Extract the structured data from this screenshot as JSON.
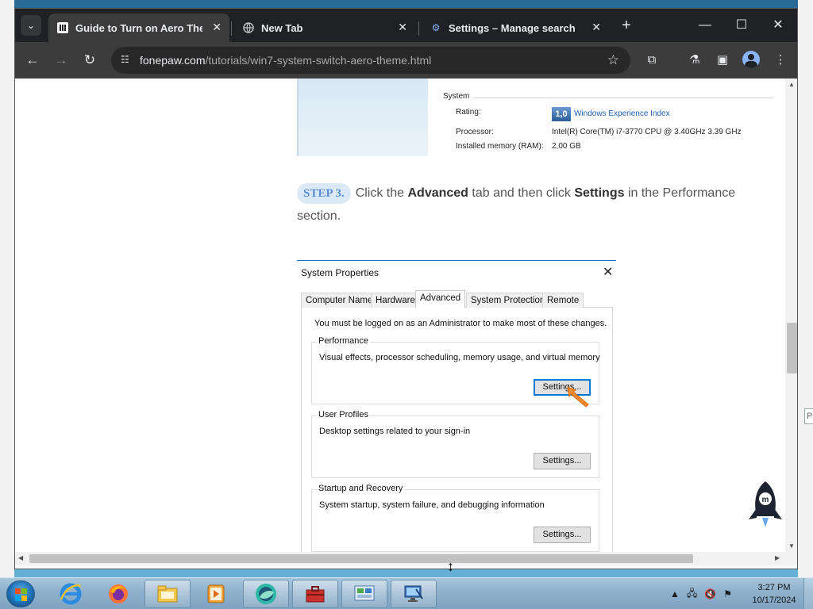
{
  "browser": {
    "tabs": [
      {
        "title": "Guide to Turn on Aero Theme",
        "favicon": "fonepaw-icon",
        "active": true
      },
      {
        "title": "New Tab",
        "favicon": "globe-icon",
        "active": false
      },
      {
        "title": "Settings – Manage search engi",
        "favicon": "gear-icon",
        "active": false
      }
    ],
    "url_host": "fonepaw.com",
    "url_path": "/tutorials/win7-system-switch-aero-theme.html"
  },
  "page": {
    "system_section": {
      "heading": "System",
      "rating_label": "Rating:",
      "rating_value": "1,0",
      "rating_link": "Windows Experience Index",
      "processor_label": "Processor:",
      "processor_value": "Intel(R) Core(TM) i7-3770 CPU @ 3.40GHz   3.39 GHz",
      "memory_label": "Installed memory (RAM):",
      "memory_value": "2,00 GB"
    },
    "step": {
      "badge": "STEP 3.",
      "text_1": "Click the ",
      "bold_1": "Advanced",
      "text_2": " tab and then click ",
      "bold_2": "Settings",
      "text_3": " in the Performance section."
    },
    "dialog": {
      "title": "System Properties",
      "close": "✕",
      "tabs": [
        "Computer Name",
        "Hardware",
        "Advanced",
        "System Protection",
        "Remote"
      ],
      "active_tab": "Advanced",
      "admin_note": "You must be logged on as an Administrator to make most of these changes.",
      "groups": [
        {
          "title": "Performance",
          "desc": "Visual effects, processor scheduling, memory usage, and virtual memory",
          "button": "Settings..."
        },
        {
          "title": "User Profiles",
          "desc": "Desktop settings related to your sign-in",
          "button": "Settings..."
        },
        {
          "title": "Startup and Recovery",
          "desc": "System startup, system failure, and debugging information",
          "button": "Settings..."
        }
      ]
    }
  },
  "taskbar": {
    "clock_time": "3:27 PM",
    "clock_date": "10/17/2024",
    "apps": [
      "internet-explorer-icon",
      "firefox-icon",
      "file-explorer-icon",
      "media-player-icon",
      "chrome-like-icon",
      "toolbox-icon",
      "control-panel-icon",
      "remote-desktop-icon"
    ]
  },
  "colors": {
    "chrome_dark": "#202124",
    "chrome_toolbar": "#3c3c3c",
    "step_badge_bg": "#dbe9f7",
    "step_badge_text": "#5a8fd0",
    "accent_arrow": "#f28a2e",
    "dialog_focus": "#0078d7"
  }
}
